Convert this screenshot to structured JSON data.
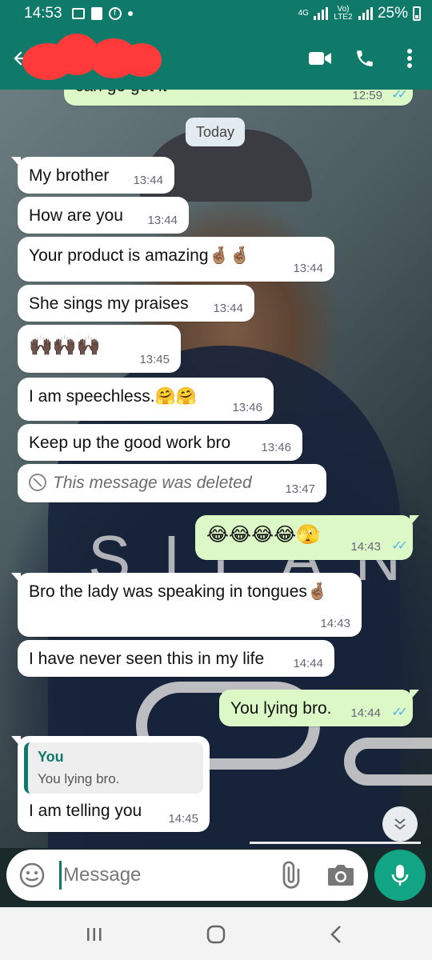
{
  "status_bar": {
    "time": "14:53",
    "network": "4G",
    "volte": "Vo) LTE2",
    "battery": "25%"
  },
  "header": {
    "back_icon": "arrow-left-icon",
    "contact_name_redacted": true,
    "video_icon": "video-call-icon",
    "call_icon": "phone-icon",
    "menu_icon": "more-vert-icon"
  },
  "chat": {
    "top_partial": {
      "text": "can go get it",
      "time": "12:59"
    },
    "date_chip": "Today",
    "messages": [
      {
        "dir": "in",
        "text": "My brother",
        "time": "13:44"
      },
      {
        "dir": "in",
        "text": "How are you",
        "time": "13:44"
      },
      {
        "dir": "in",
        "text": "Your product is amazing🤞🏽🤞🏽",
        "time": "13:44"
      },
      {
        "dir": "in",
        "text": "She sings my praises",
        "time": "13:44"
      },
      {
        "dir": "in",
        "text": "🙌🏿🙌🏿🙌🏿",
        "time": "13:45"
      },
      {
        "dir": "in",
        "text": "I am speechless.🤗🤗",
        "time": "13:46"
      },
      {
        "dir": "in",
        "text": "Keep up the good work bro",
        "time": "13:46"
      },
      {
        "dir": "in",
        "text": "This message was deleted",
        "time": "13:47"
      },
      {
        "dir": "out",
        "text": "😂😂😂😂🫣",
        "time": "14:43"
      },
      {
        "dir": "in",
        "text": "Bro the lady was speaking in tongues🤞🏽",
        "time": "14:43"
      },
      {
        "dir": "in",
        "text": "I have never seen this in my life",
        "time": "14:44"
      },
      {
        "dir": "out",
        "text": "You lying bro.",
        "time": "14:44"
      },
      {
        "dir": "in",
        "text": "I am telling you",
        "time": "14:45",
        "reply_name": "You",
        "reply_text": "You lying bro."
      }
    ]
  },
  "input": {
    "placeholder": "Message",
    "emoji_icon": "emoji-icon",
    "attach_icon": "paperclip-icon",
    "camera_icon": "camera-icon",
    "mic_icon": "mic-icon"
  },
  "colors": {
    "header": "#0f7a6a",
    "outgoing_bubble": "#dcf8c6",
    "incoming_bubble": "#ffffff",
    "read_ticks": "#4fb6ec",
    "mic_button": "#12a585"
  }
}
